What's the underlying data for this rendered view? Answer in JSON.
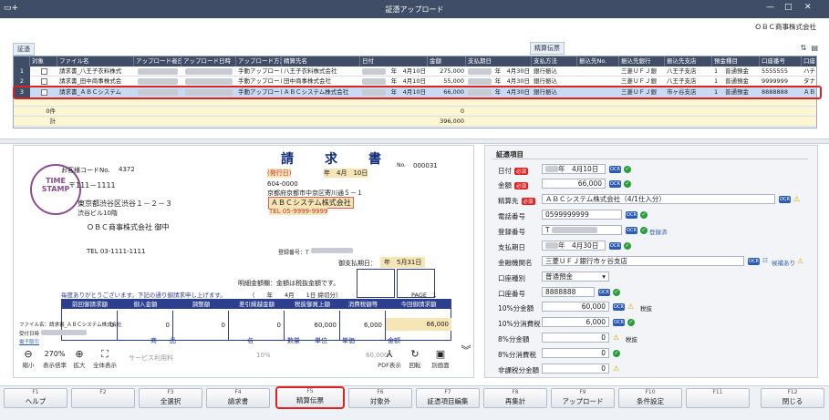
{
  "window": {
    "title": "証憑アップロード",
    "icon": "doc-plus-icon"
  },
  "company": "ＯＢＣ商事株式会社",
  "grid_label": "証憑",
  "grid_label2": "精算伝票",
  "grid": {
    "columns": [
      "対象",
      "ファイル名",
      "アップロード者氏",
      "アップロード日時",
      "アップロード方法",
      "精算先名",
      "日付",
      "金額",
      "支払期日",
      "支払方法",
      "振込先No.",
      "振込先銀行",
      "振込先支店",
      "預金種目",
      "口座番号",
      "口座"
    ],
    "rows": [
      {
        "no": "1",
        "file": "請求書_八王子衣料株式",
        "method": "手動アップロード",
        "payee": "八王子衣料株式会社",
        "date": "年　4月10日",
        "amount": "275,000",
        "due": "年　4月30日",
        "pay": "銀行振込",
        "bank": "三菱ＵＦＪ銀",
        "branch": "八王子支店",
        "kind_no": "1",
        "kind": "普通預金",
        "acct": "5555555",
        "acct2": "ハチ"
      },
      {
        "no": "2",
        "file": "請求書_田中商事株式会",
        "method": "手動アップロード",
        "payee": "田中商事株式会社",
        "date": "年　4月10日",
        "amount": "55,000",
        "due": "年　4月30日",
        "pay": "銀行振込",
        "bank": "三菱ＵＦＪ銀",
        "branch": "八王子支店",
        "kind_no": "1",
        "kind": "普通預金",
        "acct": "9999999",
        "acct2": "タナ"
      },
      {
        "no": "3",
        "file": "請求書_ＡＢＣシステム",
        "method": "手動アップロード",
        "payee": "ＡＢＣシステム株式会社",
        "date": "年　4月10日",
        "amount": "66,000",
        "due": "年　4月30日",
        "pay": "銀行振込",
        "bank": "三菱ＵＦＪ銀",
        "branch": "市ヶ谷支店",
        "kind_no": "1",
        "kind": "普通預金",
        "acct": "8888888",
        "acct2": "ＡＢ"
      }
    ],
    "count_label": "0件",
    "count_value": "0",
    "total_label": "計",
    "total_value": "396,000"
  },
  "invoice": {
    "stamp_line1": "TIME",
    "stamp_line2": "STAMP",
    "title": "請　求　書",
    "customer_code_label": "お客様コードNo.",
    "customer_code": "4372",
    "tel1": "〒111－1111",
    "addr1": "東京都渋谷区渋谷１－２－３",
    "addr2": "渋谷ビル10階",
    "to_name": "ＯＢＣ商事株式会社 御中",
    "to_tel": "TEL 03-1111-1111",
    "issue_label": "(発行日)",
    "issue_date": "年　4月　10日",
    "no_label": "No.",
    "no": "000031",
    "zip": "604-0000",
    "from_addr": "京都府京都市中京区寄川通５－１",
    "from_name": "ＡＢＣシステム株式会社",
    "from_tel": "TEL 05-9999-9999",
    "reg_label": "登録番号：T",
    "due_label": "御支払期日：",
    "due_value": "年　5月31日",
    "detail_note": "明細金額欄：金額は税抜金額です。",
    "thanks": "毎度ありがとうございます。下記の通り御請求申し上げます。",
    "period": "（　　年　　4月　　1日 締切分）",
    "page": "PAGE　1",
    "table_headers": [
      "前回御請求額",
      "御入金額",
      "調整額",
      "差引繰越金額",
      "税抜御買上額",
      "消費税額等",
      "今回御請求額"
    ],
    "table_values": [
      "0",
      "0",
      "0",
      "0",
      "60,000",
      "6,000",
      "66,000"
    ],
    "file_label": "ファイル名：請求書_ＡＢＣシステム株式会社",
    "uploader_label": "受付日時",
    "blur_label": "電子取引",
    "goods_header": "商　　品",
    "goods_header2": "名",
    "goods_cols": [
      "数量",
      "単位",
      "単価",
      "金額"
    ],
    "goods_item": "サービス利用料",
    "goods_pct": "10%",
    "goods_amount": "60,000",
    "zoom": "270%",
    "tb_shrink": "縮小",
    "tb_zoomlabel": "表示倍率",
    "tb_expand": "拡大",
    "tb_fit": "全体表示",
    "tb_pdf": "PDF表示",
    "tb_rotate": "回転",
    "tb_newwin": "別画面"
  },
  "fields": {
    "section_title": "証憑項目",
    "date_label": "日付",
    "date_value": "年　4月10日",
    "amount_label": "金額",
    "amount_value": "66,000",
    "payee_label": "精算先",
    "payee_value": "ＡＢＣシステム株式会社（4/1仕入分）",
    "phone_label": "電話番号",
    "phone_value": "0599999999",
    "reg_label": "登録番号",
    "reg_value": "T",
    "reg_link": "登録済",
    "due_label": "支払期日",
    "due_value": "年　4月30日",
    "bank_label": "金融機関名",
    "bank_value": "三菱ＵＦＪ銀行市ヶ谷支店",
    "bank_link": "候補あり",
    "acctkind_label": "口座種別",
    "acctkind_value": "普通預金",
    "acct_label": "口座番号",
    "acct_value": "8888888",
    "t10_label": "10%分金額",
    "t10_value": "60,000",
    "t10tax_label": "10%分消費税",
    "t10tax_value": "6,000",
    "t8_label": "8%分金額",
    "t8_value": "0",
    "t8tax_label": "8%分消費税",
    "t8tax_value": "0",
    "nontax_label": "非課税分金額",
    "nontax_value": "0",
    "ocr": "OCR",
    "tax": "税抜",
    "required": "必須"
  },
  "fkeys": [
    {
      "key": "F1",
      "label": "ヘルプ"
    },
    {
      "key": "F2",
      "label": ""
    },
    {
      "key": "F3",
      "label": "全選択"
    },
    {
      "key": "F4",
      "label": "請求書"
    },
    {
      "key": "F5",
      "label": "精算伝票"
    },
    {
      "key": "F6",
      "label": "対象外"
    },
    {
      "key": "F7",
      "label": "証憑項目編集"
    },
    {
      "key": "F8",
      "label": "再集計"
    },
    {
      "key": "F9",
      "label": "アップロード"
    },
    {
      "key": "F10",
      "label": "条件設定"
    },
    {
      "key": "F11",
      "label": ""
    },
    {
      "key": "F12",
      "label": "閉じる"
    }
  ]
}
